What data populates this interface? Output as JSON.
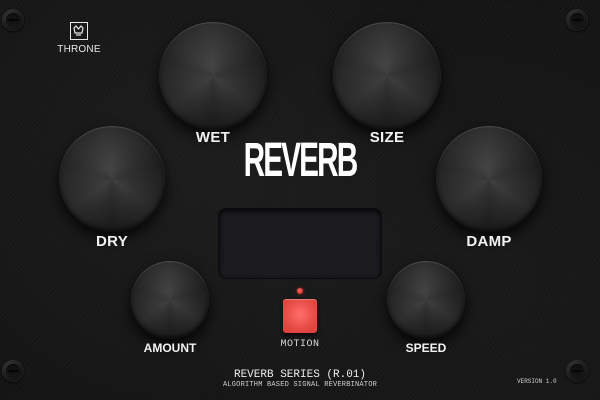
{
  "brand": {
    "logo_text": "THRONE"
  },
  "plugin": {
    "title": "REVERB"
  },
  "knobs": {
    "wet": "WET",
    "size": "SIZE",
    "dry": "DRY",
    "damp": "DAMP",
    "amount": "AMOUNT",
    "speed": "SPEED"
  },
  "motion": {
    "label": "MOTION",
    "led_color": "#d0322a",
    "button_color": "#f0524c"
  },
  "footer": {
    "series": "REVERB SERIES (R.01)",
    "subtitle": "ALGORITHM BASED SIGNAL REVERBINATOR",
    "version": "VERSION 1.0"
  },
  "colors": {
    "panel": "#131313",
    "text": "#f2f2f2",
    "display": "#1c1c20"
  }
}
